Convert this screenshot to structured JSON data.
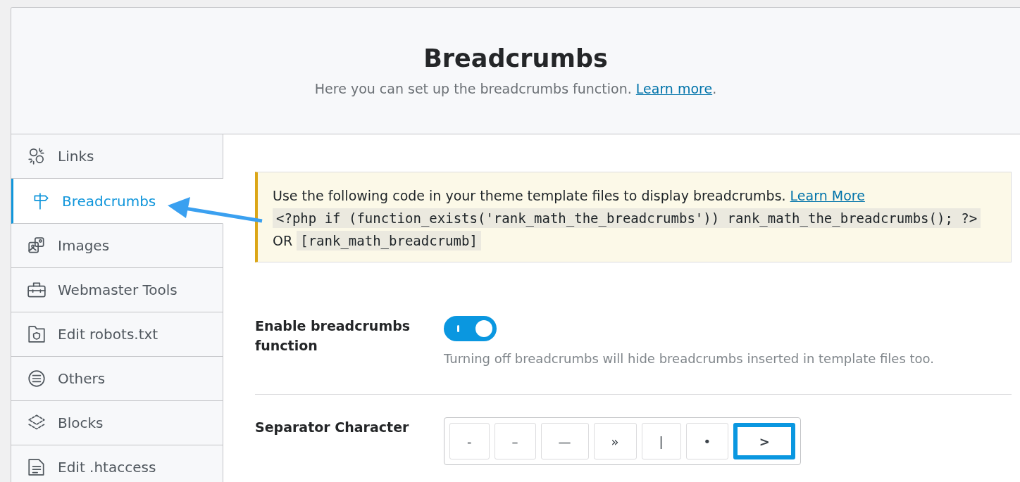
{
  "header": {
    "title": "Breadcrumbs",
    "description": "Here you can set up the breadcrumbs function. ",
    "link": "Learn more",
    "end": "."
  },
  "sidebar": {
    "items": [
      {
        "label": "Links",
        "selected": false
      },
      {
        "label": "Breadcrumbs",
        "selected": true
      },
      {
        "label": "Images",
        "selected": false
      },
      {
        "label": "Webmaster Tools",
        "selected": false
      },
      {
        "label": "Edit robots.txt",
        "selected": false
      },
      {
        "label": "Others",
        "selected": false
      },
      {
        "label": "Blocks",
        "selected": false
      },
      {
        "label": "Edit .htaccess",
        "selected": false
      }
    ]
  },
  "notice": {
    "text": "Use the following code in your theme template files to display breadcrumbs. ",
    "link": "Learn More",
    "code": [
      "<?php if (function_exists('rank_math_the_breadcrumbs')) rank_math_the_breadcrumbs(); ?>",
      "[rank_math_breadcrumb]"
    ],
    "joiner": "OR"
  },
  "settings": [
    {
      "kind": "toggle",
      "label": "Enable breadcrumbs function",
      "on": true,
      "help": "Turning off breadcrumbs will hide breadcrumbs inserted in template files too."
    },
    {
      "kind": "choices",
      "label": "Separator Character",
      "options": [
        {
          "label": "-",
          "selected": false
        },
        {
          "label": "–",
          "selected": false
        },
        {
          "label": "—",
          "selected": false
        },
        {
          "label": "»",
          "selected": false
        },
        {
          "label": "|",
          "selected": false
        },
        {
          "label": "•",
          "selected": false
        },
        {
          "label": ">",
          "selected": true
        }
      ]
    }
  ]
}
